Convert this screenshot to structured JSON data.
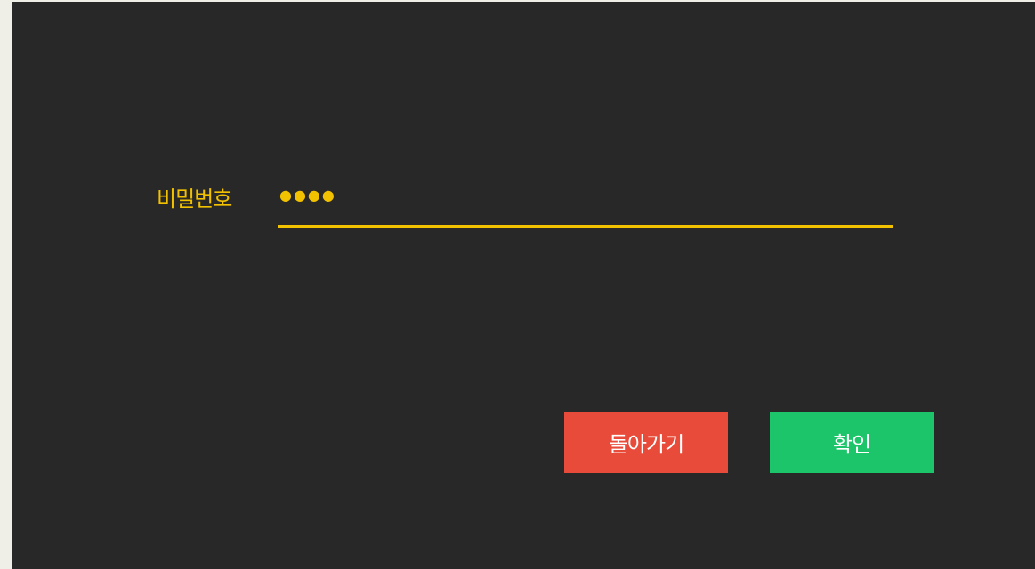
{
  "password": {
    "label": "비밀번호",
    "masked_value": "●●●●"
  },
  "buttons": {
    "back_label": "돌아가기",
    "confirm_label": "확인"
  },
  "colors": {
    "background": "#282828",
    "accent": "#f2c200",
    "back_button": "#e84b3a",
    "confirm_button": "#1dc56a"
  }
}
